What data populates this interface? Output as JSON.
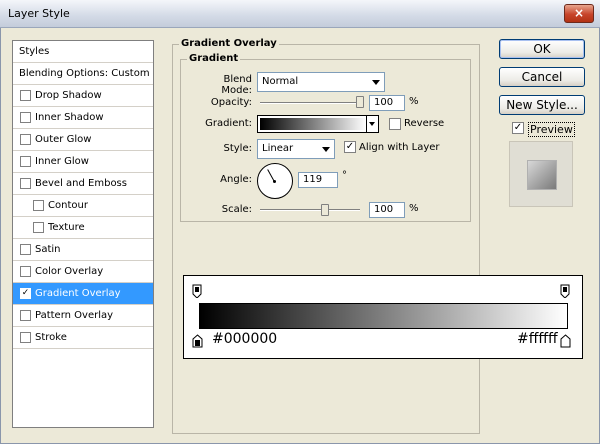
{
  "window": {
    "title": "Layer Style",
    "close_label": "×"
  },
  "styles": {
    "header": "Styles",
    "blending": "Blending Options: Custom",
    "items": [
      {
        "label": "Drop Shadow",
        "checked": false,
        "indent": false
      },
      {
        "label": "Inner Shadow",
        "checked": false,
        "indent": false
      },
      {
        "label": "Outer Glow",
        "checked": false,
        "indent": false
      },
      {
        "label": "Inner Glow",
        "checked": false,
        "indent": false
      },
      {
        "label": "Bevel and Emboss",
        "checked": false,
        "indent": false
      },
      {
        "label": "Contour",
        "checked": false,
        "indent": true
      },
      {
        "label": "Texture",
        "checked": false,
        "indent": true
      },
      {
        "label": "Satin",
        "checked": false,
        "indent": false
      },
      {
        "label": "Color Overlay",
        "checked": false,
        "indent": false
      },
      {
        "label": "Gradient Overlay",
        "checked": true,
        "indent": false,
        "selected": true
      },
      {
        "label": "Pattern Overlay",
        "checked": false,
        "indent": false
      },
      {
        "label": "Stroke",
        "checked": false,
        "indent": false
      }
    ]
  },
  "panel": {
    "title": "Gradient Overlay",
    "subtitle": "Gradient",
    "blend_mode_label": "Blend Mode:",
    "blend_mode_value": "Normal",
    "opacity_label": "Opacity:",
    "opacity_value": "100",
    "opacity_unit": "%",
    "opacity_level": 1.0,
    "gradient_label": "Gradient:",
    "reverse_label": "Reverse",
    "reverse_checked": false,
    "style_label": "Style:",
    "style_value": "Linear",
    "align_label": "Align with Layer",
    "align_checked": true,
    "angle_label": "Angle:",
    "angle_value": "119",
    "angle_unit": "°",
    "scale_label": "Scale:",
    "scale_value": "100",
    "scale_unit": "%",
    "scale_level": 0.5
  },
  "buttons": {
    "ok": "OK",
    "cancel": "Cancel",
    "new_style": "New Style..."
  },
  "preview": {
    "label": "Preview",
    "checked": true
  },
  "gradient_editor": {
    "start_color": "#000000",
    "end_color": "#ffffff",
    "check_mark": "✓"
  }
}
